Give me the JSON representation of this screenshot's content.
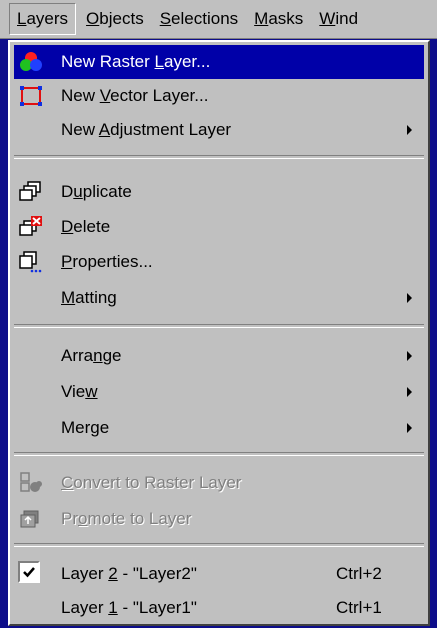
{
  "menubar": {
    "items": [
      {
        "pre": "",
        "u": "L",
        "post": "ayers"
      },
      {
        "pre": "",
        "u": "O",
        "post": "bjects"
      },
      {
        "pre": "",
        "u": "S",
        "post": "elections"
      },
      {
        "pre": "",
        "u": "M",
        "post": "asks"
      },
      {
        "pre": "",
        "u": "W",
        "post": "ind"
      }
    ]
  },
  "menu": {
    "new_raster": {
      "pre": "New Raster ",
      "u": "L",
      "post": "ayer..."
    },
    "new_vector": {
      "pre": "New ",
      "u": "V",
      "post": "ector Layer..."
    },
    "new_adjust": {
      "pre": "New ",
      "u": "A",
      "post": "djustment Layer"
    },
    "duplicate": {
      "pre": "D",
      "u": "u",
      "post": "plicate"
    },
    "delete": {
      "pre": "",
      "u": "D",
      "post": "elete"
    },
    "properties": {
      "pre": "",
      "u": "P",
      "post": "roperties..."
    },
    "matting": {
      "pre": "",
      "u": "M",
      "post": "atting"
    },
    "arrange": {
      "pre": "Arra",
      "u": "n",
      "post": "ge"
    },
    "view": {
      "pre": "Vie",
      "u": "w",
      "post": ""
    },
    "merge": {
      "pre": "Mer",
      "u": "g",
      "post": "e"
    },
    "convert": {
      "pre": "",
      "u": "C",
      "post": "onvert to Raster Layer"
    },
    "promote": {
      "pre": "Pr",
      "u": "o",
      "post": "mote to Layer"
    },
    "layer2": {
      "pre": "Layer ",
      "u": "2",
      "post": " - \"Layer2\"",
      "shortcut": "Ctrl+2"
    },
    "layer1": {
      "pre": "Layer ",
      "u": "1",
      "post": " - \"Layer1\"",
      "shortcut": "Ctrl+1"
    }
  },
  "colors": {
    "highlight": "#0000a8",
    "face": "#c0c0c0",
    "desktop": "#0d0d8a"
  },
  "icons": {
    "new_raster": "color-circles-icon",
    "new_vector": "vector-frame-icon",
    "duplicate": "duplicate-layers-icon",
    "delete": "delete-layer-icon",
    "properties": "layer-properties-icon",
    "convert": "convert-layer-icon",
    "promote": "promote-layer-icon",
    "check": "checkmark-icon"
  }
}
